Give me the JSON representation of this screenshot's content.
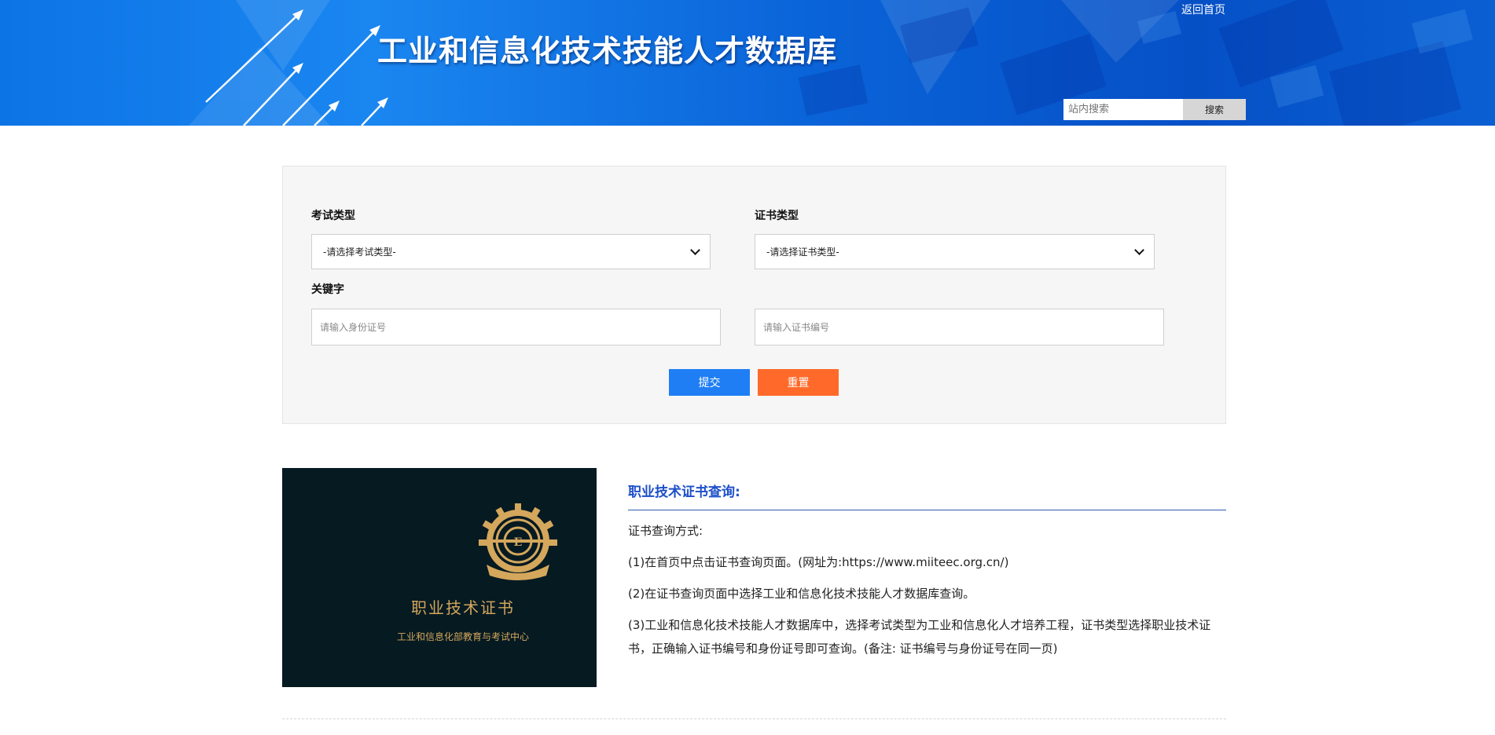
{
  "header": {
    "title": "工业和信息化技术技能人才数据库",
    "home_link": "返回首页",
    "search_placeholder": "站内搜索",
    "search_button": "搜索"
  },
  "query_form": {
    "exam_type_label": "考试类型",
    "exam_type_selected": "-请选择考试类型-",
    "cert_type_label": "证书类型",
    "cert_type_selected": "-请选择证书类型-",
    "keyword_label": "关键字",
    "id_placeholder": "请输入身份证号",
    "cert_no_placeholder": "请输入证书编号",
    "submit_label": "提交",
    "reset_label": "重置"
  },
  "certificate_image": {
    "title": "职业技术证书",
    "subtitle": "工业和信息化部教育与考试中心",
    "emblem_text": "EDUCATION & EXAMINATION CENTER OF MIIT"
  },
  "info": {
    "title": "职业技术证书查询:",
    "paragraphs": [
      "证书查询方式:",
      "(1)在首页中点击证书查询页面。(网址为:https://www.miiteec.org.cn/)",
      "(2)在证书查询页面中选择工业和信息化技术技能人才数据库查询。",
      "(3)工业和信息化技术技能人才数据库中，选择考试类型为工业和信息化人才培养工程，证书类型选择职业技术证书，正确输入证书编号和身份证号即可查询。(备注: 证书编号与身份证号在同一页)"
    ]
  },
  "colors": {
    "banner_blue": "#0d74e6",
    "submit_blue": "#1f7ef4",
    "reset_orange": "#ff6a2a",
    "info_title_blue": "#1d4fc8",
    "cert_gold": "#d4a75c",
    "cert_bg": "#061a22"
  }
}
